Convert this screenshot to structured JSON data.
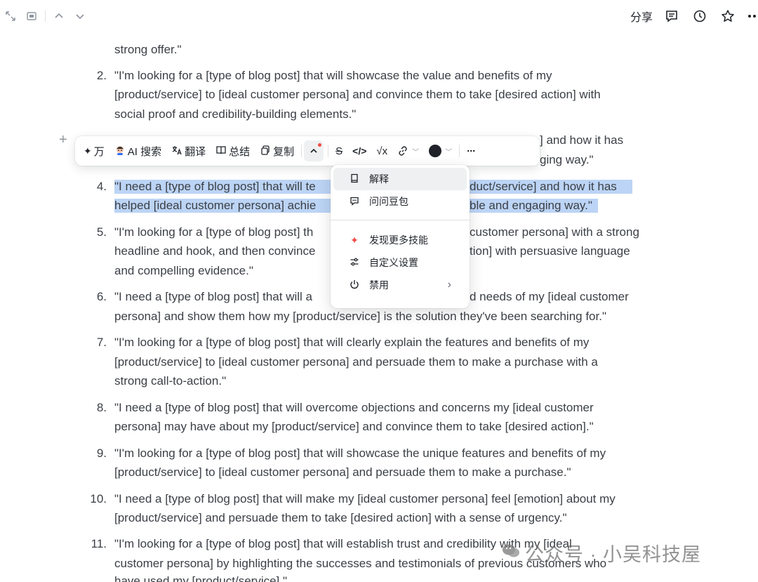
{
  "topbar": {
    "share_label": "分享",
    "left_icons": [
      "collapse-icon",
      "panel-icon",
      "chevron-up-icon",
      "chevron-down-icon"
    ],
    "right_icons": [
      "comment-icon",
      "history-icon",
      "star-icon",
      "more-icon"
    ]
  },
  "document": {
    "top_partial": "strong offer.\"",
    "items": [
      {
        "num": "2.",
        "lines": [
          "\"I'm looking for a [type of blog post] that will showcase the value and benefits of my",
          "[product/service] to [ideal customer persona] and convince them to take [desired action] with",
          "social proof and credibility-building elements.\""
        ]
      },
      {
        "num": "3.",
        "lines": [
          "] and how it has",
          "ging way.\""
        ]
      },
      {
        "num": "4.",
        "lines": [
          "\"I need a [type of blog post] that will te",
          "duct/service] and how it has",
          "helped [ideal customer persona] achie",
          "ble and engaging way.\""
        ]
      },
      {
        "num": "5.",
        "lines": [
          "\"I'm looking for a [type of blog post] th",
          "customer persona] with a strong",
          "headline and hook, and then convince",
          "tion] with persuasive language",
          "and compelling evidence.\""
        ]
      },
      {
        "num": "6.",
        "lines": [
          "\"I need a [type of blog post] that will a",
          "d needs of my [ideal customer",
          "persona] and show them how my [product/service] is the solution they've been searching for.\""
        ]
      },
      {
        "num": "7.",
        "lines": [
          "\"I'm looking for a [type of blog post] that will clearly explain the features and benefits of my",
          "[product/service] to [ideal customer persona] and persuade them to make a purchase with a",
          "strong call-to-action.\""
        ]
      },
      {
        "num": "8.",
        "lines": [
          "\"I need a [type of blog post] that will overcome objections and concerns my [ideal customer",
          "persona] may have about my [product/service] and convince them to take [desired action].\""
        ]
      },
      {
        "num": "9.",
        "lines": [
          "\"I'm looking for a [type of blog post] that will showcase the unique features and benefits of my",
          "[product/service] to [ideal customer persona] and persuade them to make a purchase.\""
        ]
      },
      {
        "num": "10.",
        "lines": [
          "\"I need a [type of blog post] that will make my [ideal customer persona] feel [emotion] about my",
          "[product/service] and persuade them to take [desired action] with a sense of urgency.\""
        ]
      },
      {
        "num": "11.",
        "lines": [
          "\"I'm looking for a [type of blog post] that will establish trust and credibility with my [ideal",
          "customer persona] by highlighting the successes and testimonials of previous customers who",
          "have used my [product/service].\""
        ]
      }
    ]
  },
  "toolbar": {
    "wan_label": "万",
    "ai_search": "AI 搜索",
    "translate": "翻译",
    "summary": "总结",
    "copy": "复制",
    "strike_glyph": "S",
    "code_glyph": "</>",
    "formula_glyph": "√x",
    "link_glyph": "🔗",
    "more_glyph": "···"
  },
  "menu": {
    "items": [
      {
        "label": "解释",
        "icon": "book-icon"
      },
      {
        "label": "问问豆包",
        "icon": "chat-icon"
      },
      {
        "label": "发现更多技能",
        "icon": "sparkle-icon"
      },
      {
        "label": "自定义设置",
        "icon": "sliders-icon"
      },
      {
        "label": "禁用",
        "icon": "power-icon"
      }
    ]
  },
  "watermark": {
    "text": "公众号 · 小吴科技屋"
  },
  "colors": {
    "highlight": "#bcd4f5",
    "text": "#3b3f45",
    "accent_red": "#f54a45",
    "sparkle_red": "#f54a45"
  }
}
